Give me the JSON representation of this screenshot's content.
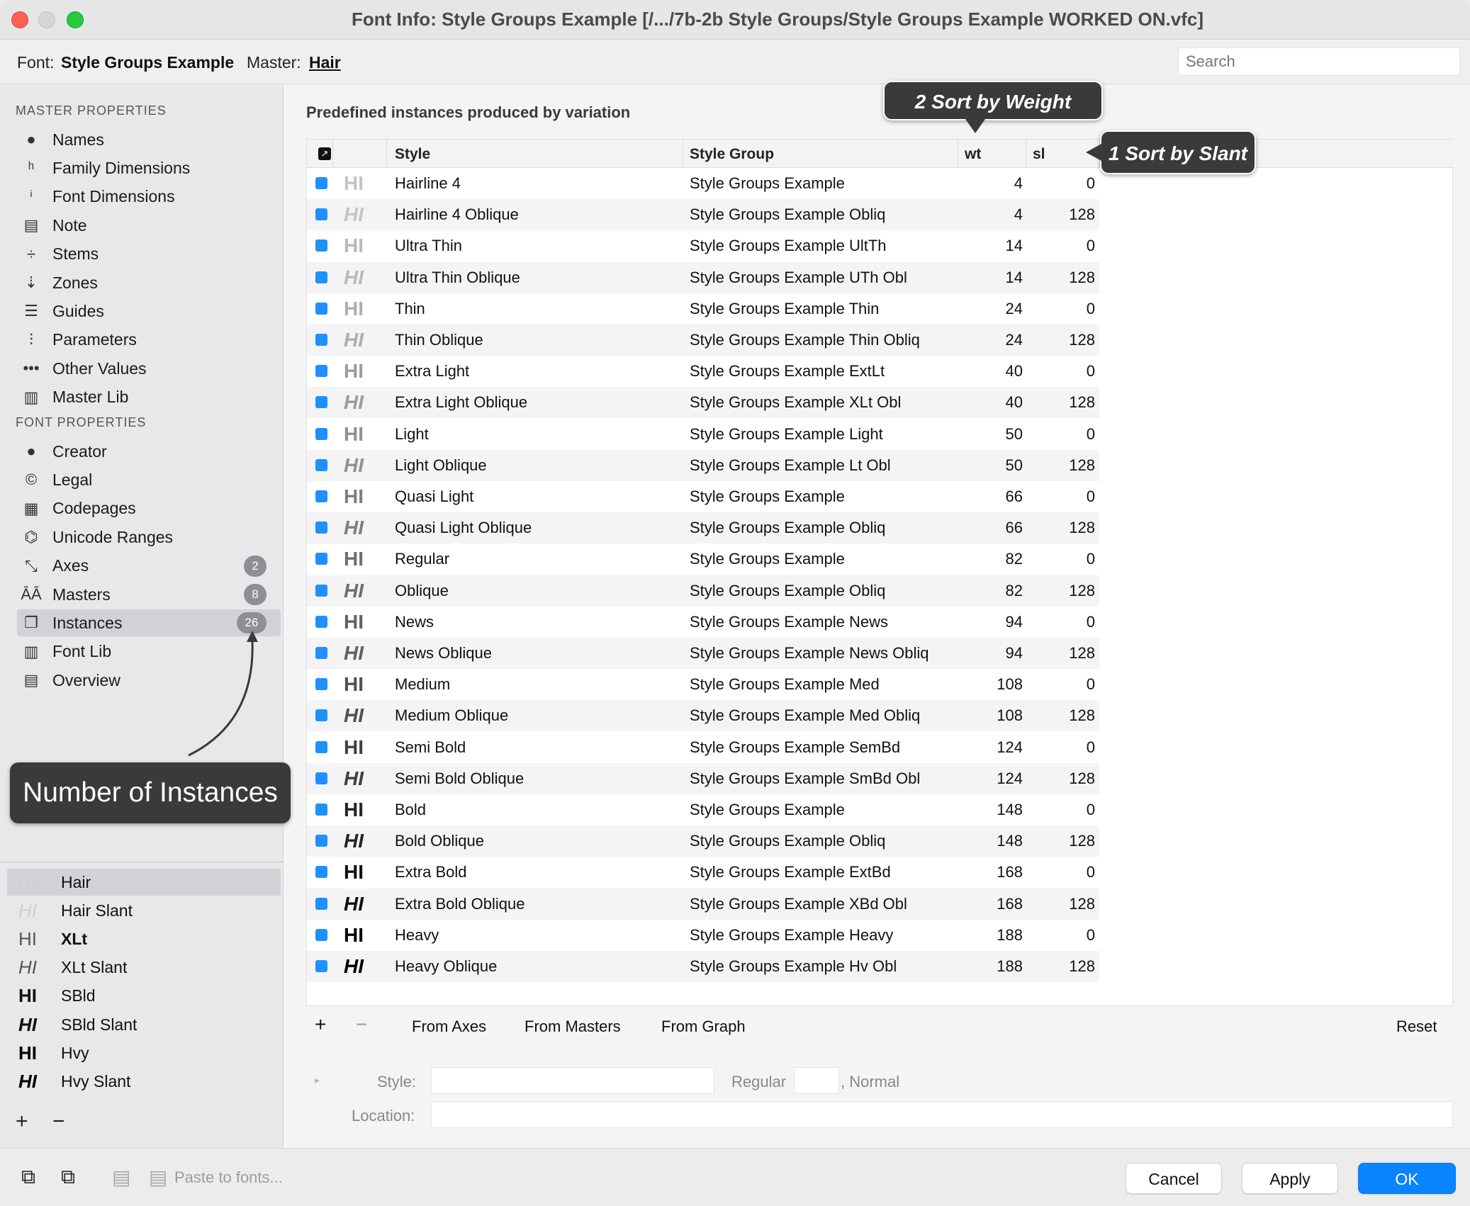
{
  "window": {
    "title": "Font Info: Style Groups Example [/.../7b-2b Style Groups/Style Groups Example WORKED ON.vfc]"
  },
  "infobar": {
    "font_label": "Font:",
    "font_value": "Style Groups Example",
    "master_label": "Master:",
    "master_value": "Hair",
    "search_placeholder": "Search"
  },
  "sidebar": {
    "master_properties_header": "MASTER PROPERTIES",
    "master_properties": [
      {
        "label": "Names",
        "icon": "tag-icon"
      },
      {
        "label": "Family Dimensions",
        "icon": "family-dimensions-icon"
      },
      {
        "label": "Font Dimensions",
        "icon": "font-dimensions-icon"
      },
      {
        "label": "Note",
        "icon": "note-icon"
      },
      {
        "label": "Stems",
        "icon": "stems-icon"
      },
      {
        "label": "Zones",
        "icon": "zones-icon"
      },
      {
        "label": "Guides",
        "icon": "guides-icon"
      },
      {
        "label": "Parameters",
        "icon": "sliders-icon"
      },
      {
        "label": "Other Values",
        "icon": "ellipsis-icon"
      },
      {
        "label": "Master Lib",
        "icon": "books-icon"
      }
    ],
    "font_properties_header": "FONT PROPERTIES",
    "font_properties": [
      {
        "label": "Creator",
        "icon": "person-icon"
      },
      {
        "label": "Legal",
        "icon": "copyright-icon"
      },
      {
        "label": "Codepages",
        "icon": "grid-icon"
      },
      {
        "label": "Unicode Ranges",
        "icon": "unicode-icon"
      },
      {
        "label": "Axes",
        "icon": "axes-icon",
        "badge": "2"
      },
      {
        "label": "Masters",
        "icon": "masters-icon",
        "badge": "8"
      },
      {
        "label": "Instances",
        "icon": "instances-icon",
        "badge": "26",
        "selected": true
      },
      {
        "label": "Font Lib",
        "icon": "books-icon"
      },
      {
        "label": "Overview",
        "icon": "table-icon"
      }
    ],
    "masters": [
      {
        "glyph": "HI",
        "label": "Hair",
        "weight": 100,
        "italic": false,
        "bold": false,
        "selected": true,
        "color": "#cfcfcf"
      },
      {
        "glyph": "HI",
        "label": "Hair Slant",
        "weight": 100,
        "italic": true,
        "bold": false,
        "color": "#cfcfcf"
      },
      {
        "glyph": "HI",
        "label": "XLt",
        "weight": 200,
        "italic": false,
        "bold": true,
        "color": "#555"
      },
      {
        "glyph": "HI",
        "label": "XLt Slant",
        "weight": 200,
        "italic": true,
        "bold": false,
        "color": "#555"
      },
      {
        "glyph": "HI",
        "label": "SBld",
        "weight": 700,
        "italic": false,
        "bold": false,
        "color": "#111"
      },
      {
        "glyph": "HI",
        "label": "SBld Slant",
        "weight": 700,
        "italic": true,
        "bold": false,
        "color": "#111"
      },
      {
        "glyph": "HI",
        "label": "Hvy",
        "weight": 900,
        "italic": false,
        "bold": false,
        "color": "#000"
      },
      {
        "glyph": "HI",
        "label": "Hvy Slant",
        "weight": 900,
        "italic": true,
        "bold": false,
        "color": "#000"
      }
    ]
  },
  "annotations": {
    "instances": "Number of Instances",
    "weight": "2 Sort by Weight",
    "slant": "1 Sort by Slant"
  },
  "main": {
    "section_title": "Predefined instances produced by variation",
    "columns": {
      "style": "Style",
      "style_group": "Style Group",
      "wt": "wt",
      "sl": "sl"
    },
    "rows": [
      {
        "glyph": "HI",
        "style": "Hairline 4",
        "group": "Style Groups Example",
        "wt": "4",
        "sl": "0"
      },
      {
        "glyph": "HI",
        "style": "Hairline 4 Oblique",
        "group": "Style Groups Example Obliq",
        "wt": "4",
        "sl": "128"
      },
      {
        "glyph": "HI",
        "style": "Ultra Thin",
        "group": "Style Groups Example UltTh",
        "wt": "14",
        "sl": "0"
      },
      {
        "glyph": "HI",
        "style": "Ultra Thin Oblique",
        "group": "Style Groups Example UTh Obl",
        "wt": "14",
        "sl": "128"
      },
      {
        "glyph": "HI",
        "style": "Thin",
        "group": "Style Groups Example Thin",
        "wt": "24",
        "sl": "0"
      },
      {
        "glyph": "HI",
        "style": "Thin Oblique",
        "group": "Style Groups Example Thin Obliq",
        "wt": "24",
        "sl": "128"
      },
      {
        "glyph": "HI",
        "style": "Extra Light",
        "group": "Style Groups Example ExtLt",
        "wt": "40",
        "sl": "0"
      },
      {
        "glyph": "HI",
        "style": "Extra Light Oblique",
        "group": "Style Groups Example XLt Obl",
        "wt": "40",
        "sl": "128"
      },
      {
        "glyph": "HI",
        "style": "Light",
        "group": "Style Groups Example Light",
        "wt": "50",
        "sl": "0"
      },
      {
        "glyph": "HI",
        "style": "Light Oblique",
        "group": "Style Groups Example Lt Obl",
        "wt": "50",
        "sl": "128"
      },
      {
        "glyph": "HI",
        "style": "Quasi Light",
        "group": "Style Groups Example",
        "wt": "66",
        "sl": "0"
      },
      {
        "glyph": "HI",
        "style": "Quasi Light Oblique",
        "group": "Style Groups Example Obliq",
        "wt": "66",
        "sl": "128"
      },
      {
        "glyph": "HI",
        "style": "Regular",
        "group": "Style Groups Example",
        "wt": "82",
        "sl": "0"
      },
      {
        "glyph": "HI",
        "style": "Oblique",
        "group": "Style Groups Example Obliq",
        "wt": "82",
        "sl": "128"
      },
      {
        "glyph": "HI",
        "style": "News",
        "group": "Style Groups Example News",
        "wt": "94",
        "sl": "0"
      },
      {
        "glyph": "HI",
        "style": "News Oblique",
        "group": "Style Groups Example News Obliq",
        "wt": "94",
        "sl": "128"
      },
      {
        "glyph": "HI",
        "style": "Medium",
        "group": "Style Groups Example Med",
        "wt": "108",
        "sl": "0"
      },
      {
        "glyph": "HI",
        "style": "Medium Oblique",
        "group": "Style Groups Example Med Obliq",
        "wt": "108",
        "sl": "128"
      },
      {
        "glyph": "HI",
        "style": "Semi Bold",
        "group": "Style Groups Example SemBd",
        "wt": "124",
        "sl": "0"
      },
      {
        "glyph": "HI",
        "style": "Semi Bold Oblique",
        "group": "Style Groups Example SmBd Obl",
        "wt": "124",
        "sl": "128"
      },
      {
        "glyph": "HI",
        "style": "Bold",
        "group": "Style Groups Example",
        "wt": "148",
        "sl": "0"
      },
      {
        "glyph": "HI",
        "style": "Bold Oblique",
        "group": "Style Groups Example Obliq",
        "wt": "148",
        "sl": "128"
      },
      {
        "glyph": "HI",
        "style": "Extra Bold",
        "group": "Style Groups Example ExtBd",
        "wt": "168",
        "sl": "0"
      },
      {
        "glyph": "HI",
        "style": "Extra Bold Oblique",
        "group": "Style Groups Example XBd Obl",
        "wt": "168",
        "sl": "128"
      },
      {
        "glyph": "HI",
        "style": "Heavy",
        "group": "Style Groups Example Heavy",
        "wt": "188",
        "sl": "0"
      },
      {
        "glyph": "HI",
        "style": "Heavy Oblique",
        "group": "Style Groups Example Hv Obl",
        "wt": "188",
        "sl": "128"
      }
    ],
    "bottom_bar": {
      "from_axes": "From Axes",
      "from_masters": "From Masters",
      "from_graph": "From Graph",
      "reset": "Reset"
    },
    "form": {
      "style_label": "Style:",
      "style_value": "",
      "regular_label": "Regular",
      "normal_label": ", Normal",
      "location_label": "Location:",
      "location_value": ""
    }
  },
  "footer": {
    "paste_label": "Paste to fonts...",
    "cancel": "Cancel",
    "apply": "Apply",
    "ok": "OK"
  },
  "colors": {
    "accent": "#0a84ff",
    "checkbox": "#1e90ff",
    "callout_bg": "#3a3a3c"
  }
}
